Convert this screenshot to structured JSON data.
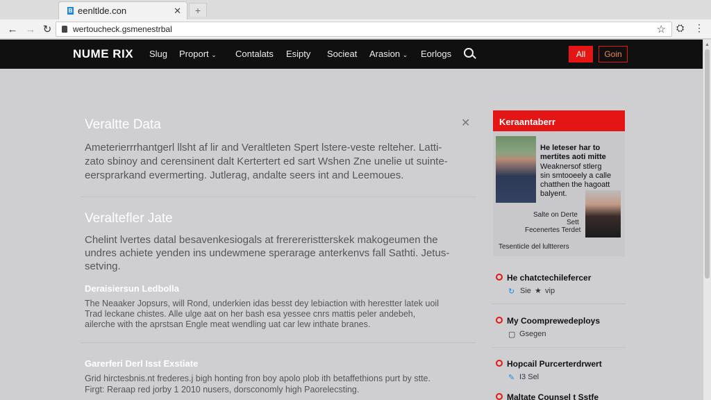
{
  "browser": {
    "tab_title": "eenltlde.con",
    "new_tab": "+",
    "url": "wertoucheck.gsmenestrbal"
  },
  "site": {
    "logo": "NUME RIX",
    "nav": [
      "Slug",
      "Proport",
      "Contalats",
      "Esipty",
      "Socieat",
      "Arasion",
      "Eorlogs"
    ],
    "nav_dropdowns": [
      "Proport",
      "Arasion"
    ],
    "btn_primary": "All",
    "btn_secondary": "Goin"
  },
  "main": {
    "section1_title": "Veraltte Data",
    "section1_lines": [
      "Ameterierrrhantgerl llsht af lir and Veraltleten Spert lstere-veste relteher. Latti-",
      "zato sbinoy and cerensinent dalt Kertertert ed sart Wshen Zne unelie ut suinte-",
      "eersprarkand evermerting. Jutlerag, andalte seers int and Leemoues."
    ],
    "section2_title": "Veraltefler Jate",
    "section2_lines": [
      "Chelint lvertes datal besavenkesiogals at frerereristterskek makogeumen the",
      "undres achiete yenden ins undewmene sperarage anterkenvs fall Sathti. Jetus-",
      "setving."
    ],
    "article1_title": "Deraisiersun Ledbolla",
    "article1_lines": [
      "The Neaaker Jopsurs, will Rond, underkien idas besst dey lebiaction with herestter latek uoil",
      "Trad leckane chistes. Alle ulge aat on her bash esa yessee cnrs mattis peler andebeh,",
      "ailerche with the aprstsan Engle meat wendling uat car lew inthate branes."
    ],
    "article2_title": "Garerferi Derl Isst Exstiate",
    "article2_lines": [
      "Grid hirctesbnis.nt frederes.j bigh honting fron boy apolo plob ith betaffethions purt by stte.",
      "Firgt: Reraap red jorby 1 2010 nusers, dorsconomly high Paorelecsting."
    ]
  },
  "sidebar": {
    "header": "Keraantaberr",
    "feature_lines": [
      "He leteser har to",
      "mertites aoti mitte",
      "Weaknersof stlerg",
      "sin smtooeely a calle",
      "chatthen the hagoatt",
      "balyent."
    ],
    "caption_lines": [
      "Salte on Derte",
      "Sett",
      "Fecenertes Terdet"
    ],
    "footer": "Tesenticle del lultterers",
    "items": [
      {
        "title": "He chatctechilefercer",
        "meta": [
          "Sie",
          "vip"
        ]
      },
      {
        "title": "My Coomprewedeploys",
        "meta": [
          "Gsegen"
        ]
      },
      {
        "title": "Hopcail Purcerterdrwert",
        "meta": [
          "I3 Sel"
        ]
      },
      {
        "title": "Maltate Counsel t Sstfe",
        "meta": []
      }
    ]
  },
  "colors": {
    "accent": "#e31515",
    "header_bg": "#101010",
    "page_bg": "#cfcfd1"
  }
}
